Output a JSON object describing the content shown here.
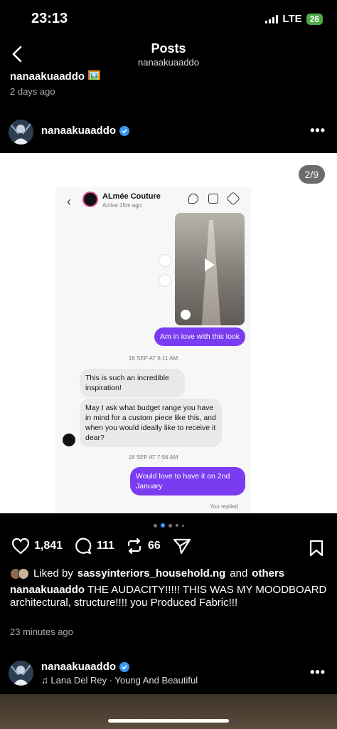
{
  "status_bar": {
    "time": "23:13",
    "network": "LTE",
    "battery": "26"
  },
  "header": {
    "title": "Posts",
    "subtitle": "nanaakuaaddo"
  },
  "previous_post": {
    "caption": "nanaakuaaddo 🖼️",
    "time": "2 days ago"
  },
  "post": {
    "username": "nanaakuaaddo",
    "counter": "2/9",
    "dm": {
      "name": "ALmée Couture",
      "active": "Active 15m ago",
      "messages": [
        {
          "side": "right",
          "text": "Am in love with this look"
        },
        {
          "stamp": "18 SEP AT 6:11 AM"
        },
        {
          "side": "left",
          "text": "This is such an incredible inspiration!"
        },
        {
          "side": "left",
          "text": "May I ask what budget range you have in mind for a custom piece like this, and when you would ideally like to receive it dear?"
        },
        {
          "stamp": "18 SEP AT 7:56 AM"
        },
        {
          "side": "right",
          "text": "Would love to have it on 2nd January"
        }
      ],
      "replied": "You replied"
    },
    "likes": "1,841",
    "comments": "111",
    "reposts": "66",
    "liked_by_prefix": "Liked by",
    "liked_by_user": "sassyinteriors_household.ng",
    "liked_by_suffix": "and",
    "liked_by_others": "others",
    "caption_user": "nanaakuaaddo",
    "caption_text": "THE AUDACITY!!!!! THIS WAS MY MOODBOARD architectural, structure!!!! you Produced Fabric!!!",
    "time": "23 minutes ago"
  },
  "next_post": {
    "username": "nanaakuaaddo",
    "song": "Lana Del Rey · Young And Beautiful"
  },
  "colors": {
    "verified": "#3897f0",
    "bubble_purple": "#7a3cf0",
    "battery": "#4ea84a"
  }
}
